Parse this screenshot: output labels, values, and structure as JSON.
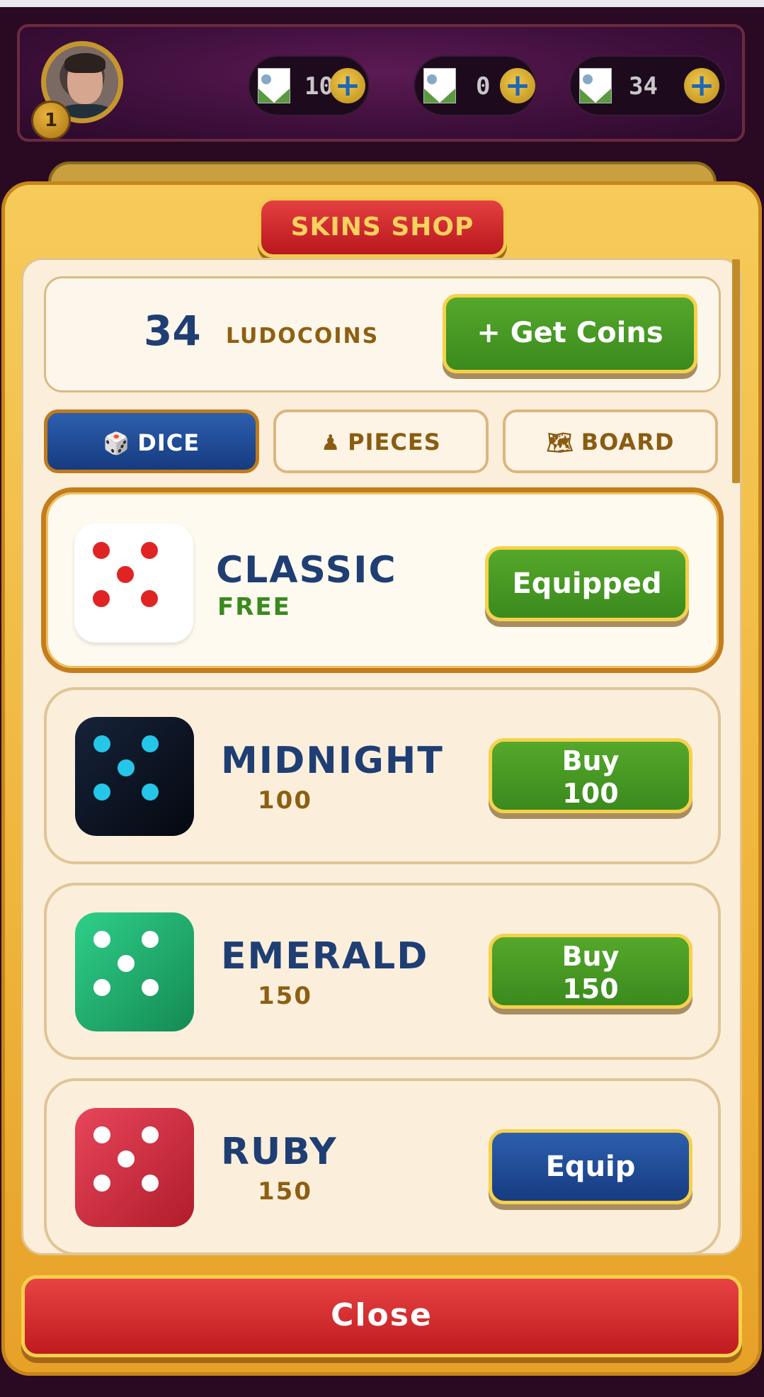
{
  "hud": {
    "level": "1",
    "stats": [
      {
        "value": "10",
        "icon": "broken-image-icon",
        "action_icon": "plus-icon"
      },
      {
        "value": "0",
        "icon": "broken-image-icon",
        "action_icon": "plus-icon"
      },
      {
        "value": "34",
        "icon": "broken-image-icon",
        "action_icon": "plus-icon"
      }
    ]
  },
  "shop": {
    "title": "SKINS SHOP",
    "coins": {
      "count": "34",
      "label": "LUDOCOINS",
      "get_button": "+ Get Coins"
    },
    "tabs": [
      {
        "label": "DICE",
        "icon": "🎲",
        "active": true
      },
      {
        "label": "PIECES",
        "icon": "♟",
        "active": false
      },
      {
        "label": "BOARD",
        "icon": "🗺",
        "active": false
      }
    ],
    "skins": [
      {
        "name": "CLASSIC",
        "price": "FREE",
        "button": "Equipped",
        "button_color": "green",
        "die_color": "#ffffff",
        "pip_color": "#e02424",
        "selected": true
      },
      {
        "name": "MIDNIGHT",
        "price": "100",
        "button_line1": "Buy",
        "button_line2": "100",
        "button_color": "green",
        "die_color": "#0c1524",
        "pip_color": "#25c6e8",
        "selected": false
      },
      {
        "name": "EMERALD",
        "price": "150",
        "button_line1": "Buy",
        "button_line2": "150",
        "button_color": "green",
        "die_color": "#1fae6e",
        "pip_color": "#ffffff",
        "selected": false
      },
      {
        "name": "RUBY",
        "price": "150",
        "button": "Equip",
        "button_color": "blue",
        "die_color": "#d42e3e",
        "pip_color": "#ffffff",
        "selected": false
      }
    ],
    "close_label": "Close"
  },
  "colors": {
    "accent_gold": "#f6d14a",
    "primary_blue": "#1f3e73",
    "green_button": "#3a8a1e",
    "red_button": "#bf1b1f",
    "price_brown": "#8e5f12"
  }
}
